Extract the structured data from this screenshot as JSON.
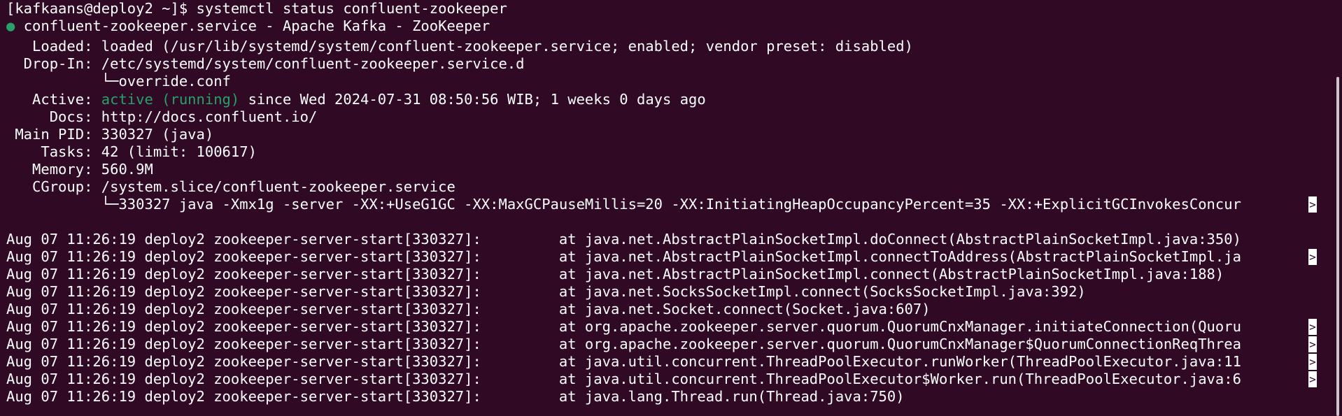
{
  "terminal": {
    "prompt": "[kafkaans@deploy2 ~]$ systemctl status confluent-zookeeper",
    "service": {
      "dot": "●",
      "header": "confluent-zookeeper.service - Apache Kafka - ZooKeeper",
      "loaded": "   Loaded: loaded (/usr/lib/systemd/system/confluent-zookeeper.service; enabled; vendor preset: disabled)",
      "dropin": "  Drop-In: /etc/systemd/system/confluent-zookeeper.service.d",
      "dropin_file": "           └─override.conf",
      "active_label": "   Active: ",
      "active_state": "active (running)",
      "active_since": " since Wed 2024-07-31 08:50:56 WIB; 1 weeks 0 days ago",
      "docs": "     Docs: http://docs.confluent.io/",
      "mainpid": " Main PID: 330327 (java)",
      "tasks": "    Tasks: 42 (limit: 100617)",
      "memory": "   Memory: 560.9M",
      "cgroup": "   CGroup: /system.slice/confluent-zookeeper.service",
      "cgroup_proc": "           └─330327 java -Xmx1g -server -XX:+UseG1GC -XX:MaxGCPauseMillis=20 -XX:InitiatingHeapOccupancyPercent=35 -XX:+ExplicitGCInvokesConcur"
    },
    "logs": [
      "Aug 07 11:26:19 deploy2 zookeeper-server-start[330327]:         at java.net.AbstractPlainSocketImpl.doConnect(AbstractPlainSocketImpl.java:350)",
      "Aug 07 11:26:19 deploy2 zookeeper-server-start[330327]:         at java.net.AbstractPlainSocketImpl.connectToAddress(AbstractPlainSocketImpl.ja",
      "Aug 07 11:26:19 deploy2 zookeeper-server-start[330327]:         at java.net.AbstractPlainSocketImpl.connect(AbstractPlainSocketImpl.java:188)",
      "Aug 07 11:26:19 deploy2 zookeeper-server-start[330327]:         at java.net.SocksSocketImpl.connect(SocksSocketImpl.java:392)",
      "Aug 07 11:26:19 deploy2 zookeeper-server-start[330327]:         at java.net.Socket.connect(Socket.java:607)",
      "Aug 07 11:26:19 deploy2 zookeeper-server-start[330327]:         at org.apache.zookeeper.server.quorum.QuorumCnxManager.initiateConnection(Quoru",
      "Aug 07 11:26:19 deploy2 zookeeper-server-start[330327]:         at org.apache.zookeeper.server.quorum.QuorumCnxManager$QuorumConnectionReqThrea",
      "Aug 07 11:26:19 deploy2 zookeeper-server-start[330327]:         at java.util.concurrent.ThreadPoolExecutor.runWorker(ThreadPoolExecutor.java:11",
      "Aug 07 11:26:19 deploy2 zookeeper-server-start[330327]:         at java.util.concurrent.ThreadPoolExecutor$Worker.run(ThreadPoolExecutor.java:6",
      "Aug 07 11:26:19 deploy2 zookeeper-server-start[330327]:         at java.lang.Thread.run(Thread.java:750)"
    ],
    "truncation_marker": ">",
    "colors": {
      "background": "#300a24",
      "text": "#ffffff",
      "active_green": "#26a269"
    }
  }
}
